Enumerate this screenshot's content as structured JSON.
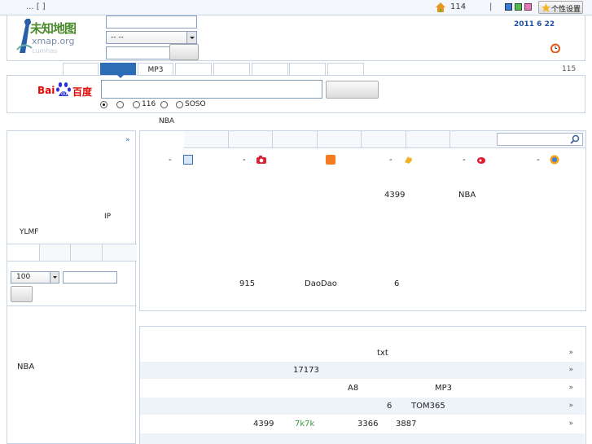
{
  "topbar": {
    "left_text": "... [ ]",
    "count": "114",
    "settings_label": "个性设置"
  },
  "logo": {
    "text": "未知地图",
    "domain": "xmap.org",
    "sub": "cumhas"
  },
  "header": {
    "city_select": "-- --",
    "date": "2011 6 22"
  },
  "search": {
    "tabs": [
      "",
      "",
      "MP3",
      "",
      "",
      "",
      "",
      ""
    ],
    "count": "115",
    "brand": "Baidu百度",
    "radios": [
      "",
      "",
      "116",
      "",
      "SOSO"
    ],
    "hot": "NBA"
  },
  "left": {
    "more": "»",
    "ip_text": "IP",
    "ylmf": "YLMF",
    "select_value": "100",
    "bottom_text": "NBA"
  },
  "sites": {
    "row1_dashes": [
      "-",
      "-",
      "-",
      "-"
    ],
    "t4399": "4399",
    "tnba": "NBA",
    "t915": "915",
    "tdaodao": "DaoDao",
    "t6": "6"
  },
  "list": {
    "rows": [
      {
        "a": "txt",
        "more": "»"
      },
      {
        "a": "17173",
        "more": "»"
      },
      {
        "a": "A8",
        "b": "MP3",
        "more": "»"
      },
      {
        "a": "6",
        "b": "TOM365",
        "more": "»"
      },
      {
        "a": "4399",
        "b": "7k7k",
        "c": "3366",
        "d": "3887",
        "more": "»"
      }
    ]
  },
  "colors": {
    "accent": "#2c6db8",
    "green": "#3b9b3b",
    "date": "#1f4f9e"
  }
}
